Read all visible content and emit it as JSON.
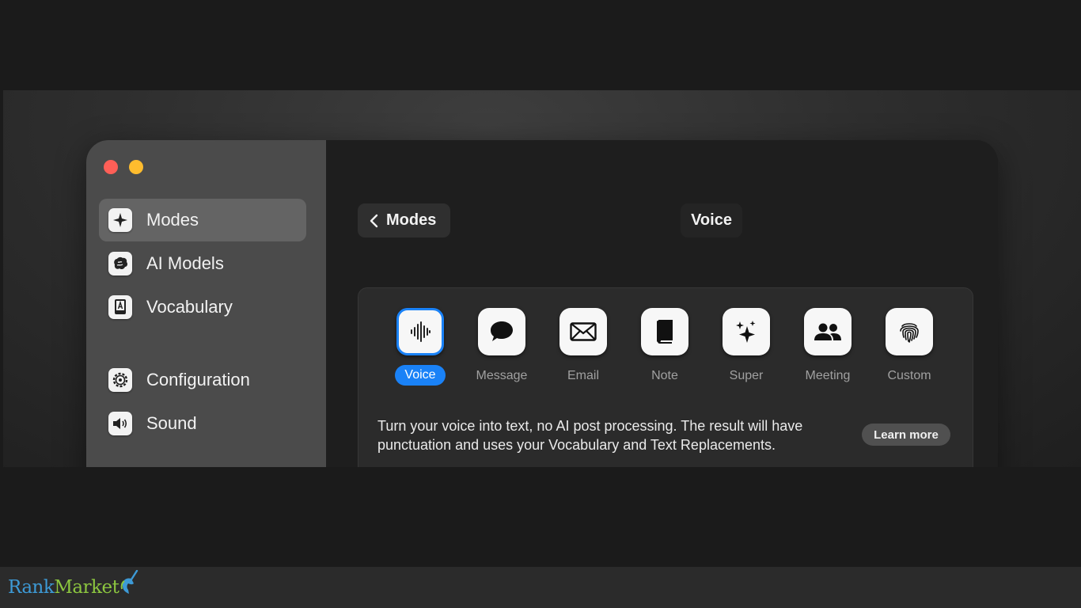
{
  "sidebar": {
    "items": [
      {
        "label": "Modes",
        "icon": "sparkle-icon",
        "active": true
      },
      {
        "label": "AI Models",
        "icon": "brain-icon",
        "active": false
      },
      {
        "label": "Vocabulary",
        "icon": "book-letter-icon",
        "active": false
      },
      {
        "label": "Configuration",
        "icon": "gear-icon",
        "active": false
      },
      {
        "label": "Sound",
        "icon": "speaker-icon",
        "active": false
      }
    ]
  },
  "header": {
    "back_label": "Modes",
    "title": "Voice"
  },
  "modes": {
    "items": [
      {
        "label": "Voice",
        "icon": "waveform-icon",
        "selected": true
      },
      {
        "label": "Message",
        "icon": "speech-bubble-icon",
        "selected": false
      },
      {
        "label": "Email",
        "icon": "envelope-icon",
        "selected": false
      },
      {
        "label": "Note",
        "icon": "notebook-icon",
        "selected": false
      },
      {
        "label": "Super",
        "icon": "sparkles-icon",
        "selected": false
      },
      {
        "label": "Meeting",
        "icon": "people-icon",
        "selected": false
      },
      {
        "label": "Custom",
        "icon": "fingerprint-icon",
        "selected": false
      }
    ],
    "description_line1": "Turn your voice into text, no AI post processing. The result will have",
    "description_line2": "punctuation and uses your Vocabulary and Text Replacements.",
    "learn_more_label": "Learn more"
  },
  "watermark": {
    "part1": "Rank",
    "part2": "Market"
  },
  "colors": {
    "accent": "#1a82f7",
    "sidebar_bg": "#4b4b4b",
    "sidebar_active": "#646464",
    "close": "#ff5f57",
    "minimize": "#febc2e"
  }
}
